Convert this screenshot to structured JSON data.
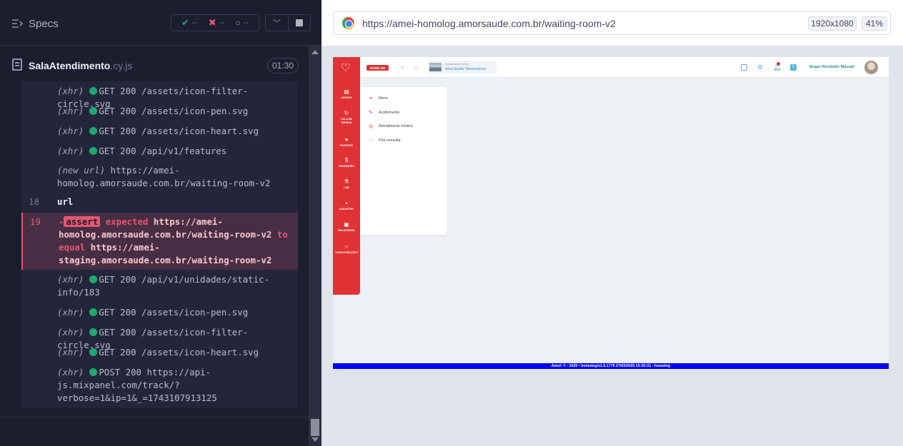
{
  "reporter": {
    "specs_label": "Specs",
    "stats": {
      "passed": "--",
      "failed": "--",
      "pending": "--"
    },
    "spec": {
      "name": "SalaAtendimento",
      "ext": ".cy.js",
      "duration": "01:30"
    },
    "log": [
      {
        "kind": "xhr",
        "label": "(xhr)",
        "text": "GET 200 /assets/icon-filter-circle.svg"
      },
      {
        "kind": "xhr",
        "label": "(xhr)",
        "text": "GET 200 /assets/icon-pen.svg"
      },
      {
        "kind": "xhr",
        "label": "(xhr)",
        "text": "GET 200 /assets/icon-heart.svg"
      },
      {
        "kind": "xhr",
        "label": "(xhr)",
        "text": "GET 200 /api/v1/features"
      },
      {
        "kind": "newurl",
        "label": "(new url)",
        "line1": "https://amei-",
        "line2": "homolog.amorsaude.com.br/waiting-room-v2"
      },
      {
        "kind": "cmd",
        "num": "18",
        "text": "url"
      },
      {
        "kind": "assert",
        "num": "19",
        "dash": "-",
        "badge": "assert",
        "expected": "expected",
        "actual1": "https://amei-",
        "actual2": "homolog.amorsaude.com.br/waiting-room-v2",
        "to": "to",
        "equal": "equal",
        "expected_val1": "https://amei-",
        "expected_val2": "staging.amorsaude.com.br/waiting-room-v2"
      },
      {
        "kind": "xhr2",
        "label": "(xhr)",
        "line1": "GET 200 /api/v1/unidades/static-",
        "line2": "info/183"
      },
      {
        "kind": "xhr",
        "label": "(xhr)",
        "text": "GET 200 /assets/icon-pen.svg"
      },
      {
        "kind": "xhr",
        "label": "(xhr)",
        "text": "GET 200 /assets/icon-filter-circle.svg"
      },
      {
        "kind": "xhr",
        "label": "(xhr)",
        "text": "GET 200 /assets/icon-heart.svg"
      },
      {
        "kind": "xhr3",
        "label": "(xhr)",
        "line1": "POST 200 https://api-",
        "line2": "js.mixpanel.com/track/?",
        "line3": "verbose=1&ip=1&_=1743107913125"
      }
    ]
  },
  "browser": {
    "url": "https://amei-homolog.amorsaude.com.br/waiting-room-v2",
    "resolution": "1920x1080",
    "zoom": "41%"
  },
  "app": {
    "home_button": "HOME DR",
    "unit_label": "Unidade/Área Clínica",
    "unit_name": "AmorSaúde Telemedicina",
    "notification_count": "9",
    "user_name": "Roger Ricobello Mazzali",
    "nav": [
      {
        "icon": "calendar-icon",
        "label": "AGENDA"
      },
      {
        "icon": "waiting-room-icon",
        "label": "SALA DE ESPERA"
      },
      {
        "icon": "patient-icon",
        "label": "PACIENTE"
      },
      {
        "icon": "finance-icon",
        "label": "FINANCEIRO"
      },
      {
        "icon": "lab-icon",
        "label": "LAB"
      },
      {
        "icon": "register-icon",
        "label": "CADASTRO"
      },
      {
        "icon": "reports-icon",
        "label": "RELATÓRIOS"
      },
      {
        "icon": "settings-icon",
        "label": "CONFIGURAÇÕES"
      }
    ],
    "menu": [
      {
        "icon": "hamburger-icon",
        "label": "Menu"
      },
      {
        "icon": "pen-icon",
        "label": "Acolhimento"
      },
      {
        "icon": "filter-circle-icon",
        "label": "Atendimento médico"
      },
      {
        "icon": "heart-icon",
        "label": "Pós-consulta"
      }
    ],
    "footer": "Amei! © - 2025 • homolog/v1.6.1778 27/03/2025 15:20:31 - homolog"
  },
  "colors": {
    "brand_red": "#e03234",
    "pass_green": "#1fa971",
    "fail_pink": "#e45770",
    "footer_blue": "#0000ff"
  }
}
